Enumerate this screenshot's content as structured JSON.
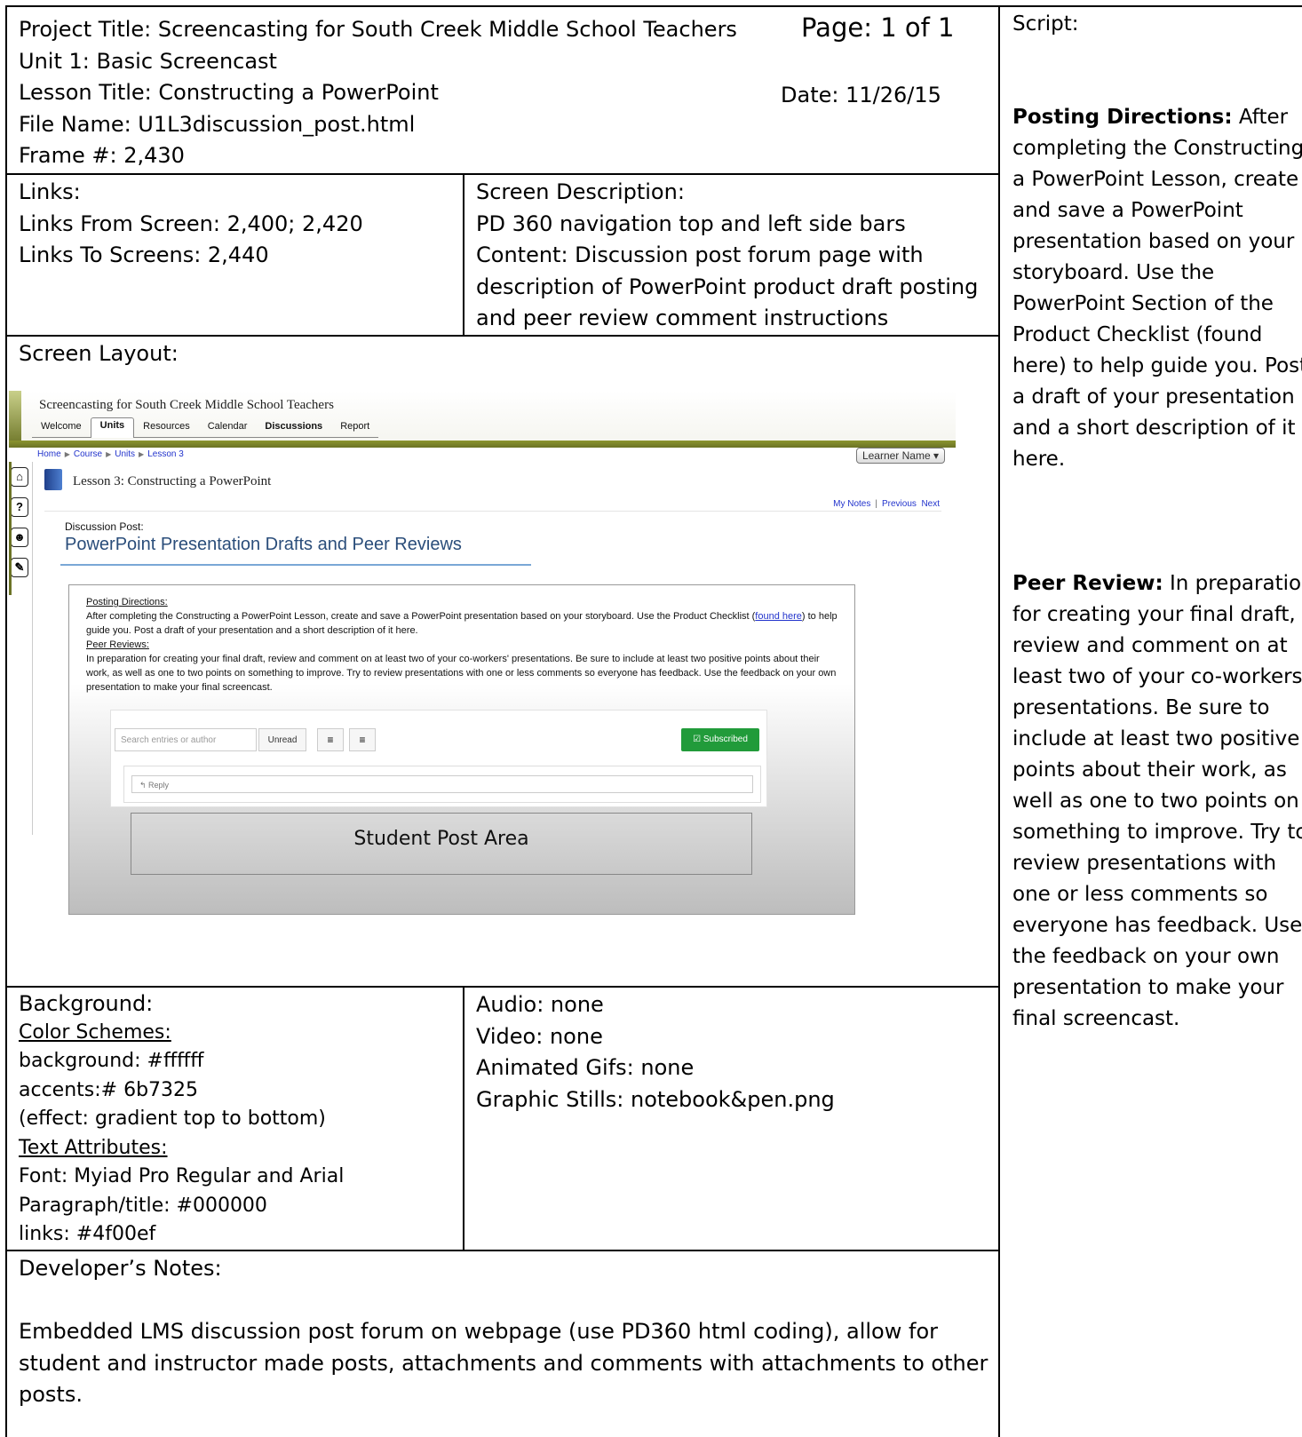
{
  "header": {
    "project_title": "Project Title: Screencasting for South Creek Middle School Teachers",
    "page": "Page: 1 of 1",
    "unit": "Unit 1: Basic Screencast",
    "lesson_title": "Lesson Title: Constructing a PowerPoint",
    "date": "Date: 11/26/15",
    "file_name": "File Name:  U1L3discussion_post.html",
    "frame": "Frame #: 2,430"
  },
  "links": {
    "heading": "Links:",
    "from": "Links From Screen: 2,400; 2,420",
    "to": "Links To Screens: 2,440"
  },
  "screen_description": {
    "heading": "Screen Description:",
    "lines": [
      "PD 360 navigation top and left side bars",
      "Content: Discussion post forum page with",
      "description of PowerPoint product draft posting",
      "and peer review comment instructions"
    ]
  },
  "screen_layout": {
    "heading": "Screen Layout:",
    "mockup": {
      "site_title": "Screencasting for South Creek Middle School Teachers",
      "nav_tabs": [
        "Welcome",
        "Units",
        "Resources",
        "Calendar",
        "Discussions",
        "Report"
      ],
      "breadcrumbs": [
        "Home",
        "Course",
        "Units",
        "Lesson 3"
      ],
      "learner_name": "Learner Name ▾",
      "sidebar_icons": [
        "⌂",
        "?",
        "☻",
        "✎"
      ],
      "lesson_title": "Lesson 3: Constructing a PowerPoint",
      "right_links": [
        "My Notes",
        "Previous",
        "Next"
      ],
      "discussion_label": "Discussion Post:",
      "discussion_title": "PowerPoint Presentation Drafts and Peer Reviews",
      "posting_heading": "Posting Directions:",
      "posting_text_1": "After completing the Constructing a PowerPoint Lesson, create and save a PowerPoint presentation based on your storyboard. Use the Product Checklist (",
      "posting_link": "found here",
      "posting_text_2": ") to help guide you. Post a draft of your presentation and a short description of it here.",
      "peer_heading": "Peer Reviews:",
      "peer_text": "In preparation for creating your final draft, review and comment on at least two of your co-workers' presentations. Be sure to include at least two positive points about their work, as well as one to two points on something to improve. Try to review presentations with one or less comments so everyone has feedback. Use the feedback on your own presentation to make your final screencast.",
      "search_placeholder": "Search entries or author",
      "unread_label": "Unread",
      "subscribed_label": "Subscribed",
      "reply_label": "Reply",
      "student_post_area": "Student Post Area"
    }
  },
  "background": {
    "heading": "Background:",
    "color_schemes_heading": "Color Schemes:",
    "background_color": "background: #ffffff",
    "accents": "accents:# 6b7325",
    "effect": "(effect: gradient top to bottom)",
    "text_attributes_heading": "Text Attributes:",
    "font": "Font: Myiad Pro Regular and Arial",
    "paragraph": "Paragraph/title: #000000",
    "links": "links: #4f00ef"
  },
  "media": {
    "audio": "Audio: none",
    "video": "Video: none",
    "gifs": "Animated Gifs: none",
    "stills": "Graphic Stills: notebook&pen.png"
  },
  "developer_notes": {
    "heading": "Developer’s Notes:",
    "lines": [
      "Embedded LMS discussion post forum on webpage (use PD360 html coding), allow for",
      "student and instructor made posts, attachments and comments with attachments to other",
      "posts."
    ]
  },
  "script": {
    "heading": "Script:",
    "posting_label": "Posting Directions:",
    "posting_lines": [
      " After",
      "completing the Constructing",
      "a PowerPoint Lesson, create",
      "and save a PowerPoint",
      "presentation based on your",
      "storyboard. Use the",
      "PowerPoint Section of the",
      "Product Checklist (found",
      "here) to help guide you. Post",
      "a draft of your presentation",
      "and a short description of it",
      "here."
    ],
    "peer_label": "Peer Review:",
    "peer_lines": [
      " In preparation",
      "for creating your final draft,",
      "review and comment on at",
      "least two of your co-workers’",
      "presentations. Be sure to",
      "include at least two positive",
      "points about their work, as",
      "well as one to two points on",
      "something to improve. Try to",
      "review presentations with",
      "one or less comments so",
      "everyone has feedback. Use",
      "the feedback on your own",
      "presentation to make your",
      "final screencast."
    ]
  },
  "colors": {
    "accent": "#6b7325",
    "link": "#2233cc",
    "subscribed": "#219b3a"
  }
}
